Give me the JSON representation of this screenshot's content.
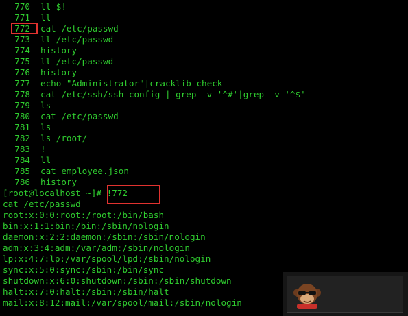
{
  "colors": {
    "background": "#000000",
    "text": "#2fcc2f",
    "highlight_box": "#e0322f"
  },
  "history": [
    {
      "num": "770",
      "cmd": "ll $!"
    },
    {
      "num": "771",
      "cmd": "ll"
    },
    {
      "num": "772",
      "cmd": "cat /etc/passwd"
    },
    {
      "num": "773",
      "cmd": "ll /etc/passwd"
    },
    {
      "num": "774",
      "cmd": "history"
    },
    {
      "num": "775",
      "cmd": "ll /etc/passwd"
    },
    {
      "num": "776",
      "cmd": "history"
    },
    {
      "num": "777",
      "cmd": "echo \"Administrator\"|cracklib-check"
    },
    {
      "num": "778",
      "cmd": "cat /etc/ssh/ssh_config | grep -v '^#'|grep -v '^$'"
    },
    {
      "num": "779",
      "cmd": "ls"
    },
    {
      "num": "780",
      "cmd": "cat /etc/passwd"
    },
    {
      "num": "781",
      "cmd": "ls"
    },
    {
      "num": "782",
      "cmd": "ls /root/"
    },
    {
      "num": "783",
      "cmd": "!"
    },
    {
      "num": "784",
      "cmd": "ll"
    },
    {
      "num": "785",
      "cmd": "cat employee.json"
    },
    {
      "num": "786",
      "cmd": "history"
    }
  ],
  "prompt": {
    "text": "[root@localhost ~]# ",
    "command": "!772"
  },
  "echo_line": "cat /etc/passwd",
  "output": [
    "root:x:0:0:root:/root:/bin/bash",
    "bin:x:1:1:bin:/bin:/sbin/nologin",
    "daemon:x:2:2:daemon:/sbin:/sbin/nologin",
    "adm:x:3:4:adm:/var/adm:/sbin/nologin",
    "lp:x:4:7:lp:/var/spool/lpd:/sbin/nologin",
    "sync:x:5:0:sync:/sbin:/bin/sync",
    "shutdown:x:6:0:shutdown:/sbin:/sbin/shutdown",
    "halt:x:7:0:halt:/sbin:/sbin/halt",
    "mail:x:8:12:mail:/var/spool/mail:/sbin/nologin"
  ],
  "watermark": {
    "icon": "monkey-sunglasses-logo-icon"
  }
}
